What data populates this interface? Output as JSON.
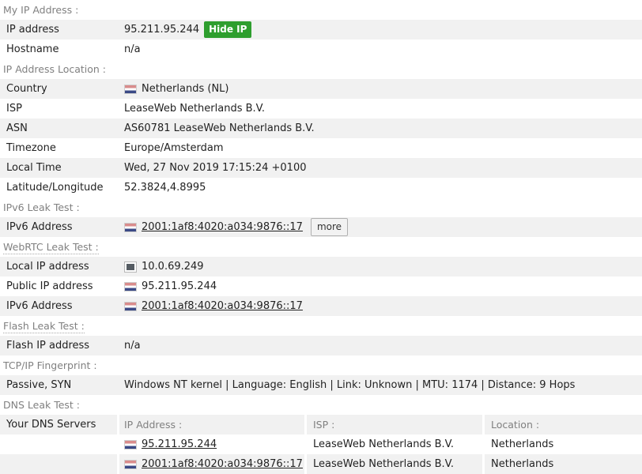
{
  "sections": {
    "my_ip": {
      "title": "My IP Address :",
      "tooltip_style": false,
      "rows": [
        {
          "label": "IP address",
          "value": "95.211.95.244",
          "button": "Hide IP"
        },
        {
          "label": "Hostname",
          "value": "n/a"
        }
      ]
    },
    "ip_location": {
      "title": "IP Address Location :",
      "tooltip_style": false,
      "rows": [
        {
          "label": "Country",
          "value": "Netherlands (NL)",
          "flag": "nl-flag-icon"
        },
        {
          "label": "ISP",
          "value": "LeaseWeb Netherlands B.V."
        },
        {
          "label": "ASN",
          "value": "AS60781 LeaseWeb Netherlands B.V."
        },
        {
          "label": "Timezone",
          "value": "Europe/Amsterdam"
        },
        {
          "label": "Local Time",
          "value": "Wed, 27 Nov 2019 17:15:24 +0100"
        },
        {
          "label": "Latitude/Longitude",
          "value": "52.3824,4.8995"
        }
      ]
    },
    "ipv6_leak": {
      "title": "IPv6 Leak Test :",
      "tooltip_style": false,
      "rows": [
        {
          "label": "IPv6 Address",
          "value": "2001:1af8:4020:a034:9876::17",
          "flag": "nl-flag-icon",
          "link": true,
          "button": "more"
        }
      ]
    },
    "webrtc_leak": {
      "title": "WebRTC Leak Test :",
      "tooltip_style": true,
      "rows": [
        {
          "label": "Local IP address",
          "value": "10.0.69.249",
          "icon": "lan-port-icon"
        },
        {
          "label": "Public IP address",
          "value": "95.211.95.244",
          "flag": "nl-flag-icon"
        },
        {
          "label": "IPv6 Address",
          "value": "2001:1af8:4020:a034:9876::17",
          "flag": "nl-flag-icon",
          "link": true
        }
      ]
    },
    "flash_leak": {
      "title": "Flash Leak Test :",
      "tooltip_style": true,
      "rows": [
        {
          "label": "Flash IP address",
          "value": "n/a"
        }
      ]
    },
    "tcpip": {
      "title": "TCP/IP Fingerprint :",
      "tooltip_style": false,
      "rows": [
        {
          "label": "Passive, SYN",
          "value": "Windows NT kernel | Language: English | Link: Unknown | MTU: 1174 | Distance: 9 Hops"
        }
      ]
    },
    "dns_leak": {
      "title": "DNS Leak Test :",
      "tooltip_style": false,
      "row_label": "Your DNS Servers",
      "columns": [
        "IP Address :",
        "ISP :",
        "Location :"
      ],
      "rows": [
        {
          "ip": "95.211.95.244",
          "isp": "LeaseWeb Netherlands B.V.",
          "location": "Netherlands",
          "flag": "nl-flag-icon"
        },
        {
          "ip": "2001:1af8:4020:a034:9876::17",
          "isp": "LeaseWeb Netherlands B.V.",
          "location": "Netherlands",
          "flag": "nl-flag-icon"
        }
      ]
    }
  },
  "colors": {
    "hide_ip_button": "#2e9e2e",
    "row_alt": "#f1f1f1",
    "section_header_text": "#808080",
    "body_text": "#222222"
  }
}
